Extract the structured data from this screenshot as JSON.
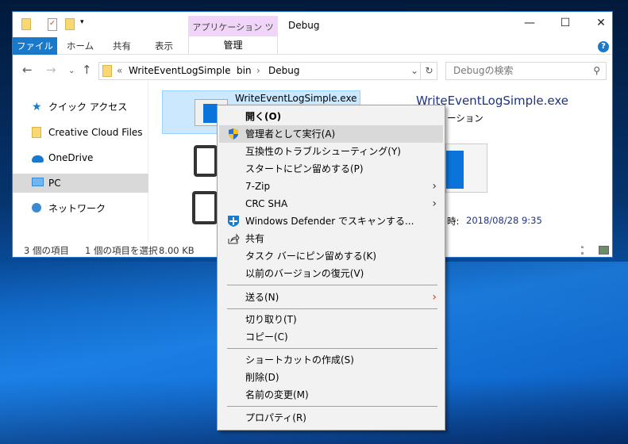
{
  "window": {
    "title": "Debug",
    "app_tools_label": "アプリケーション ツール",
    "manage_tab": "管理",
    "tabs": [
      "ファイル",
      "ホーム",
      "共有",
      "表示"
    ],
    "controls": {
      "minimize": "—",
      "maximize": "☐",
      "close": "✕"
    },
    "help": "?"
  },
  "address": {
    "overflow": "«",
    "crumbs": [
      "WriteEventLogSimple",
      "bin",
      "Debug"
    ],
    "separator": "›",
    "dropdown": "⌄",
    "refresh": "↻"
  },
  "search": {
    "placeholder": "Debugの検索",
    "icon": "search-icon"
  },
  "sidebar": {
    "items": [
      {
        "label": "クイック アクセス",
        "icon": "star-icon"
      },
      {
        "label": "Creative Cloud Files",
        "icon": "creative-cloud-folder-icon"
      },
      {
        "label": "OneDrive",
        "icon": "cloud-icon"
      },
      {
        "label": "PC",
        "icon": "monitor-icon",
        "selected": true
      },
      {
        "label": "ネットワーク",
        "icon": "network-icon"
      }
    ]
  },
  "file": {
    "name": "WriteEventLogSimple.exe"
  },
  "preview": {
    "name": "WriteEventLogSimple.exe",
    "type_partial": "ーション",
    "date_label_partial": "時:",
    "date": "2018/08/28 9:35"
  },
  "status": {
    "count": "3 個の項目",
    "selected": "1 個の項目を選択",
    "size": "8.00 KB"
  },
  "context_menu": {
    "items": [
      {
        "label": "開く(O)",
        "bold": true
      },
      {
        "label": "管理者として実行(A)",
        "icon": "uac-shield-icon",
        "highlighted": true
      },
      {
        "label": "互換性のトラブルシューティング(Y)"
      },
      {
        "label": "スタートにピン留めする(P)"
      },
      {
        "label": "7-Zip",
        "submenu": true
      },
      {
        "label": "CRC SHA",
        "submenu": true
      },
      {
        "label": "Windows Defender でスキャンする...",
        "icon": "defender-icon"
      },
      {
        "label": "共有",
        "icon": "share-icon"
      },
      {
        "label": "タスク バーにピン留めする(K)"
      },
      {
        "label": "以前のバージョンの復元(V)"
      },
      {
        "label": "送る(N)",
        "submenu": true
      },
      {
        "label": "切り取り(T)"
      },
      {
        "label": "コピー(C)"
      },
      {
        "label": "ショートカットの作成(S)"
      },
      {
        "label": "削除(D)"
      },
      {
        "label": "名前の変更(M)"
      },
      {
        "label": "プロパティ(R)"
      }
    ],
    "submenu_arrow": "›"
  }
}
